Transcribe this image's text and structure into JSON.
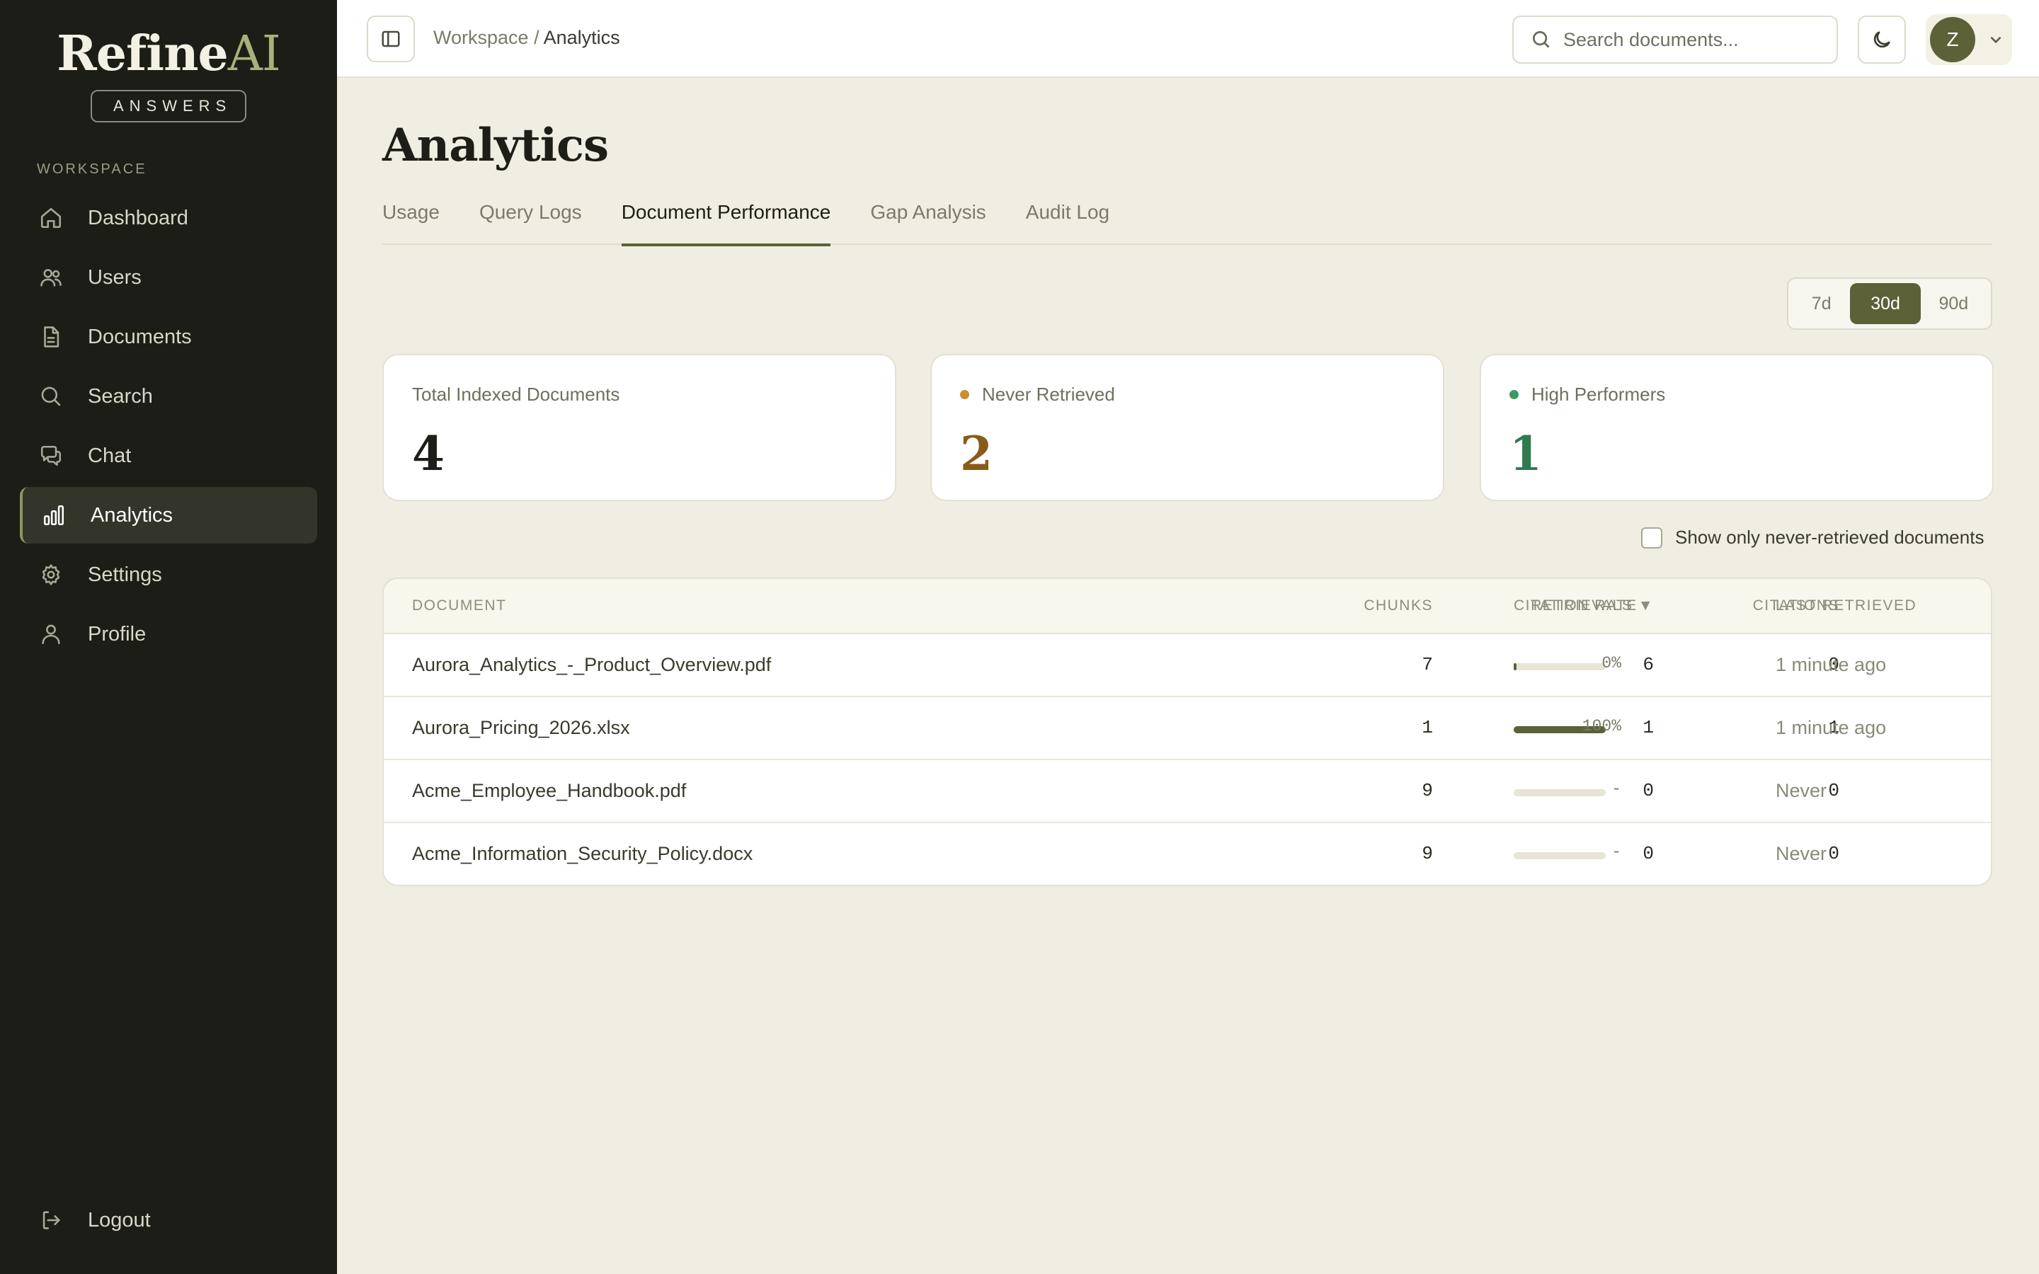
{
  "brand": {
    "name": "Refine",
    "name_accent": "AI",
    "tagline": "ANSWERS"
  },
  "sidebar": {
    "section_label": "WORKSPACE",
    "items": [
      {
        "label": "Dashboard",
        "icon": "home-icon"
      },
      {
        "label": "Users",
        "icon": "users-icon"
      },
      {
        "label": "Documents",
        "icon": "document-icon"
      },
      {
        "label": "Search",
        "icon": "search-icon"
      },
      {
        "label": "Chat",
        "icon": "chat-icon"
      },
      {
        "label": "Analytics",
        "icon": "bar-chart-icon",
        "active": true
      },
      {
        "label": "Settings",
        "icon": "gear-icon"
      },
      {
        "label": "Profile",
        "icon": "user-icon"
      }
    ],
    "logout_label": "Logout"
  },
  "topbar": {
    "breadcrumb_parent": "Workspace",
    "breadcrumb_sep": "/",
    "breadcrumb_current": "Analytics",
    "search_placeholder": "Search documents...",
    "avatar_initial": "Z"
  },
  "page": {
    "title": "Analytics",
    "tabs": [
      "Usage",
      "Query Logs",
      "Document Performance",
      "Gap Analysis",
      "Audit Log"
    ],
    "active_tab": "Document Performance",
    "ranges": [
      "7d",
      "30d",
      "90d"
    ],
    "active_range": "30d"
  },
  "stats": {
    "total": {
      "label": "Total Indexed Documents",
      "value": "4"
    },
    "never": {
      "label": "Never Retrieved",
      "value": "2",
      "color": "#8a5a1a",
      "dot": "#c9902e"
    },
    "high": {
      "label": "High Performers",
      "value": "1",
      "color": "#2f7a4e",
      "dot": "#3d9960"
    }
  },
  "filter_label": "Show only never-retrieved documents",
  "table": {
    "headers": {
      "document": "DOCUMENT",
      "chunks": "CHUNKS",
      "retrievals": "RETRIEVALS ▼",
      "citations": "CITATIONS",
      "rate": "CITATION RATE",
      "last": "LAST RETRIEVED"
    },
    "rows": [
      {
        "document": "Aurora_Analytics_-_Product_Overview.pdf",
        "chunks": "7",
        "retrievals": "6",
        "citations": "0",
        "rate": "0%",
        "rate_value": 0.03,
        "last": "1 minute ago"
      },
      {
        "document": "Aurora_Pricing_2026.xlsx",
        "chunks": "1",
        "retrievals": "1",
        "citations": "1",
        "rate": "100%",
        "rate_value": 1.0,
        "last": "1 minute ago"
      },
      {
        "document": "Acme_Employee_Handbook.pdf",
        "chunks": "9",
        "retrievals": "0",
        "citations": "0",
        "rate": "-",
        "rate_value": 0,
        "last": "Never"
      },
      {
        "document": "Acme_Information_Security_Policy.docx",
        "chunks": "9",
        "retrievals": "0",
        "citations": "0",
        "rate": "-",
        "rate_value": 0,
        "last": "Never"
      }
    ]
  }
}
